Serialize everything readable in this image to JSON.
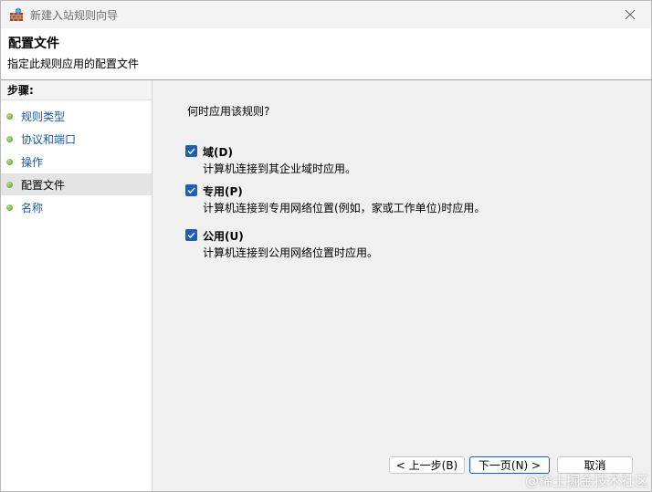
{
  "window": {
    "title": "新建入站规则向导",
    "app_icon": "firewall-wall-icon",
    "close_icon": "close-icon"
  },
  "header": {
    "title": "配置文件",
    "subtitle": "指定此规则应用的配置文件"
  },
  "sidebar": {
    "title": "步骤:",
    "items": [
      {
        "label": "规则类型",
        "active": false
      },
      {
        "label": "协议和端口",
        "active": false
      },
      {
        "label": "操作",
        "active": false
      },
      {
        "label": "配置文件",
        "active": true
      },
      {
        "label": "名称",
        "active": false
      }
    ]
  },
  "main": {
    "question": "何时应用该规则?",
    "options": [
      {
        "label": "域(D)",
        "description": "计算机连接到其企业域时应用。",
        "checked": true
      },
      {
        "label": "专用(P)",
        "description": "计算机连接到专用网络位置(例如，家或工作单位)时应用。",
        "checked": true
      },
      {
        "label": "公用(U)",
        "description": "计算机连接到公用网络位置时应用。",
        "checked": true
      }
    ]
  },
  "buttons": {
    "back": "< 上一步(B)",
    "next": "下一页(N) >",
    "cancel": "取消"
  },
  "watermark": "@稀土掘金技术社区",
  "colors": {
    "link": "#1a5aa6",
    "checkbox": "#1e5eb8",
    "step_dot": "#4e9a22"
  }
}
